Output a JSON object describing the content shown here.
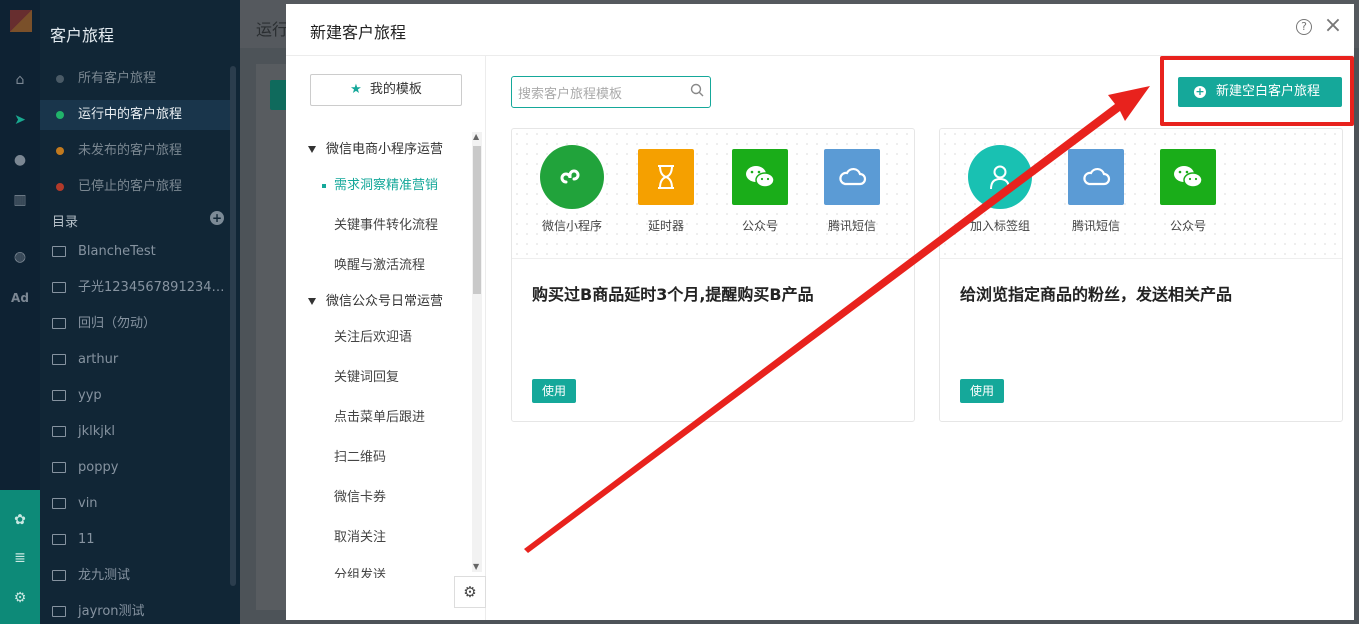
{
  "sidebar": {
    "title": "客户旅程",
    "journeys": [
      {
        "label": "所有客户旅程",
        "color": "#4a5a66"
      },
      {
        "label": "运行中的客户旅程",
        "color": "#21b36a"
      },
      {
        "label": "未发布的客户旅程",
        "color": "#c27a1e"
      },
      {
        "label": "已停止的客户旅程",
        "color": "#b23a2a"
      }
    ],
    "directory_label": "目录",
    "directory_add": "+",
    "folders": [
      "BlancheTest",
      "子光123456789123456...",
      "回归（勿动）",
      "arthur",
      "yyp",
      "jklkjkl",
      "poppy",
      "vin",
      "11",
      "龙九测试",
      "jayron测试"
    ]
  },
  "rail": {
    "icons": [
      "home-icon",
      "send-icon",
      "user-icon",
      "chart-icon",
      "wechat-icon",
      "ad-icon",
      "flow-icon",
      "server-icon",
      "settings-icon"
    ],
    "ad_label": "Ad"
  },
  "main": {
    "title": "运行"
  },
  "modal": {
    "title": "新建客户旅程",
    "help": "?",
    "close": "×",
    "my_templates": "我的模板",
    "groups": [
      {
        "label": "微信电商小程序运营",
        "items": [
          "需求洞察精准营销",
          "关键事件转化流程",
          "唤醒与激活流程"
        ]
      },
      {
        "label": "微信公众号日常运营",
        "items": [
          "关注后欢迎语",
          "关键词回复",
          "点击菜单后跟进",
          "扫二维码",
          "微信卡券",
          "取消关注",
          "分组发送"
        ]
      }
    ],
    "active_item": "需求洞察精准营销",
    "search_placeholder": "搜索客户旅程模板",
    "new_blank_button": "新建空白客户旅程",
    "cards": [
      {
        "nodes": [
          {
            "label": "微信小程序",
            "icon": "mini-program-icon",
            "color": "#21a33b"
          },
          {
            "label": "延时器",
            "icon": "hourglass-icon",
            "color": "#f5a000"
          },
          {
            "label": "公众号",
            "icon": "wechat-icon",
            "color": "#1aad19"
          },
          {
            "label": "腾讯短信",
            "icon": "cloud-icon",
            "color": "#5b9bd5"
          }
        ],
        "title": "购买过B商品延时3个月,提醒购买B产品",
        "use": "使用"
      },
      {
        "nodes": [
          {
            "label": "加入标签组",
            "icon": "user-tag-icon",
            "color": "#19c1b2"
          },
          {
            "label": "腾讯短信",
            "icon": "cloud-icon",
            "color": "#5b9bd5"
          },
          {
            "label": "公众号",
            "icon": "wechat-icon",
            "color": "#1aad19"
          }
        ],
        "title": "给浏览指定商品的粉丝，发送相关产品",
        "use": "使用"
      }
    ]
  },
  "colors": {
    "accent": "#15a89a",
    "annotation_red": "#e8221d"
  }
}
